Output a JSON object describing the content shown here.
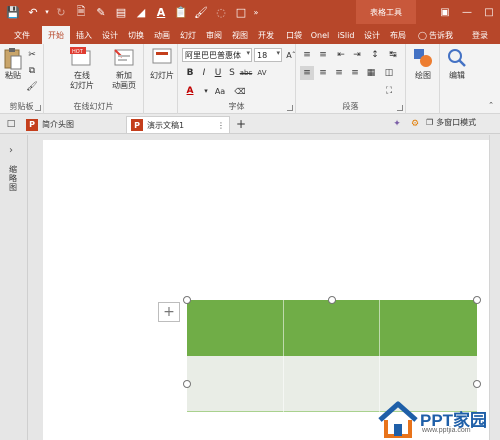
{
  "quick_access": {
    "icons": [
      "save-icon",
      "undo-icon",
      "redo-icon",
      "new-file-icon",
      "pen-icon",
      "arrange-icon",
      "fill-color-icon",
      "font-color-icon",
      "paste-icon",
      "format-painter-icon",
      "dropdown-icon",
      "customize-icon"
    ]
  },
  "titlebar": {
    "context_tab": "表格工具",
    "controls": [
      "restore-icon",
      "minimize-icon",
      "maximize-icon",
      "close-icon"
    ]
  },
  "ribbon_tabs": [
    {
      "label": "文件",
      "active": false
    },
    {
      "label": "开始",
      "active": true
    },
    {
      "label": "插入",
      "active": false
    },
    {
      "label": "设计",
      "active": false
    },
    {
      "label": "切换",
      "active": false
    },
    {
      "label": "动画",
      "active": false
    },
    {
      "label": "幻灯",
      "active": false
    },
    {
      "label": "审阅",
      "active": false
    },
    {
      "label": "视图",
      "active": false
    },
    {
      "label": "开发",
      "active": false
    },
    {
      "label": "口袋",
      "active": false
    },
    {
      "label": "Onel",
      "active": false
    },
    {
      "label": "iSlid",
      "active": false
    },
    {
      "label": "设计",
      "active": false
    },
    {
      "label": "布局",
      "active": false
    }
  ],
  "tell_me": "告诉我",
  "sign_in": "登录",
  "ribbon": {
    "clipboard": {
      "paste": "粘贴",
      "label": "剪贴板"
    },
    "online_slides": {
      "btn1_line1": "在线",
      "btn1_line2": "幻灯片",
      "btn2_line1": "新加",
      "btn2_line2": "动画页",
      "label": "在线幻灯片"
    },
    "slides": {
      "btn": "幻灯片"
    },
    "font": {
      "family": "阿里巴巴普惠体",
      "size": "18",
      "label": "字体",
      "aa": "Aa"
    },
    "paragraph": {
      "label": "段落"
    },
    "drawing": {
      "label": "绘图"
    },
    "editing": {
      "label": "编辑"
    }
  },
  "doc_tabs": [
    {
      "name": "简介头图",
      "active": false
    },
    {
      "name": "演示文稿1",
      "active": true
    }
  ],
  "multi_window": "多窗口模式",
  "thumbnail_pane": {
    "label": "缩略图"
  },
  "slide": {
    "header_color": "#70ad47",
    "row_color": "#e9ede6",
    "accent_line": "#a9d18e"
  },
  "watermark": {
    "brand": "PPT家园",
    "url": "www.pptjia.com"
  }
}
